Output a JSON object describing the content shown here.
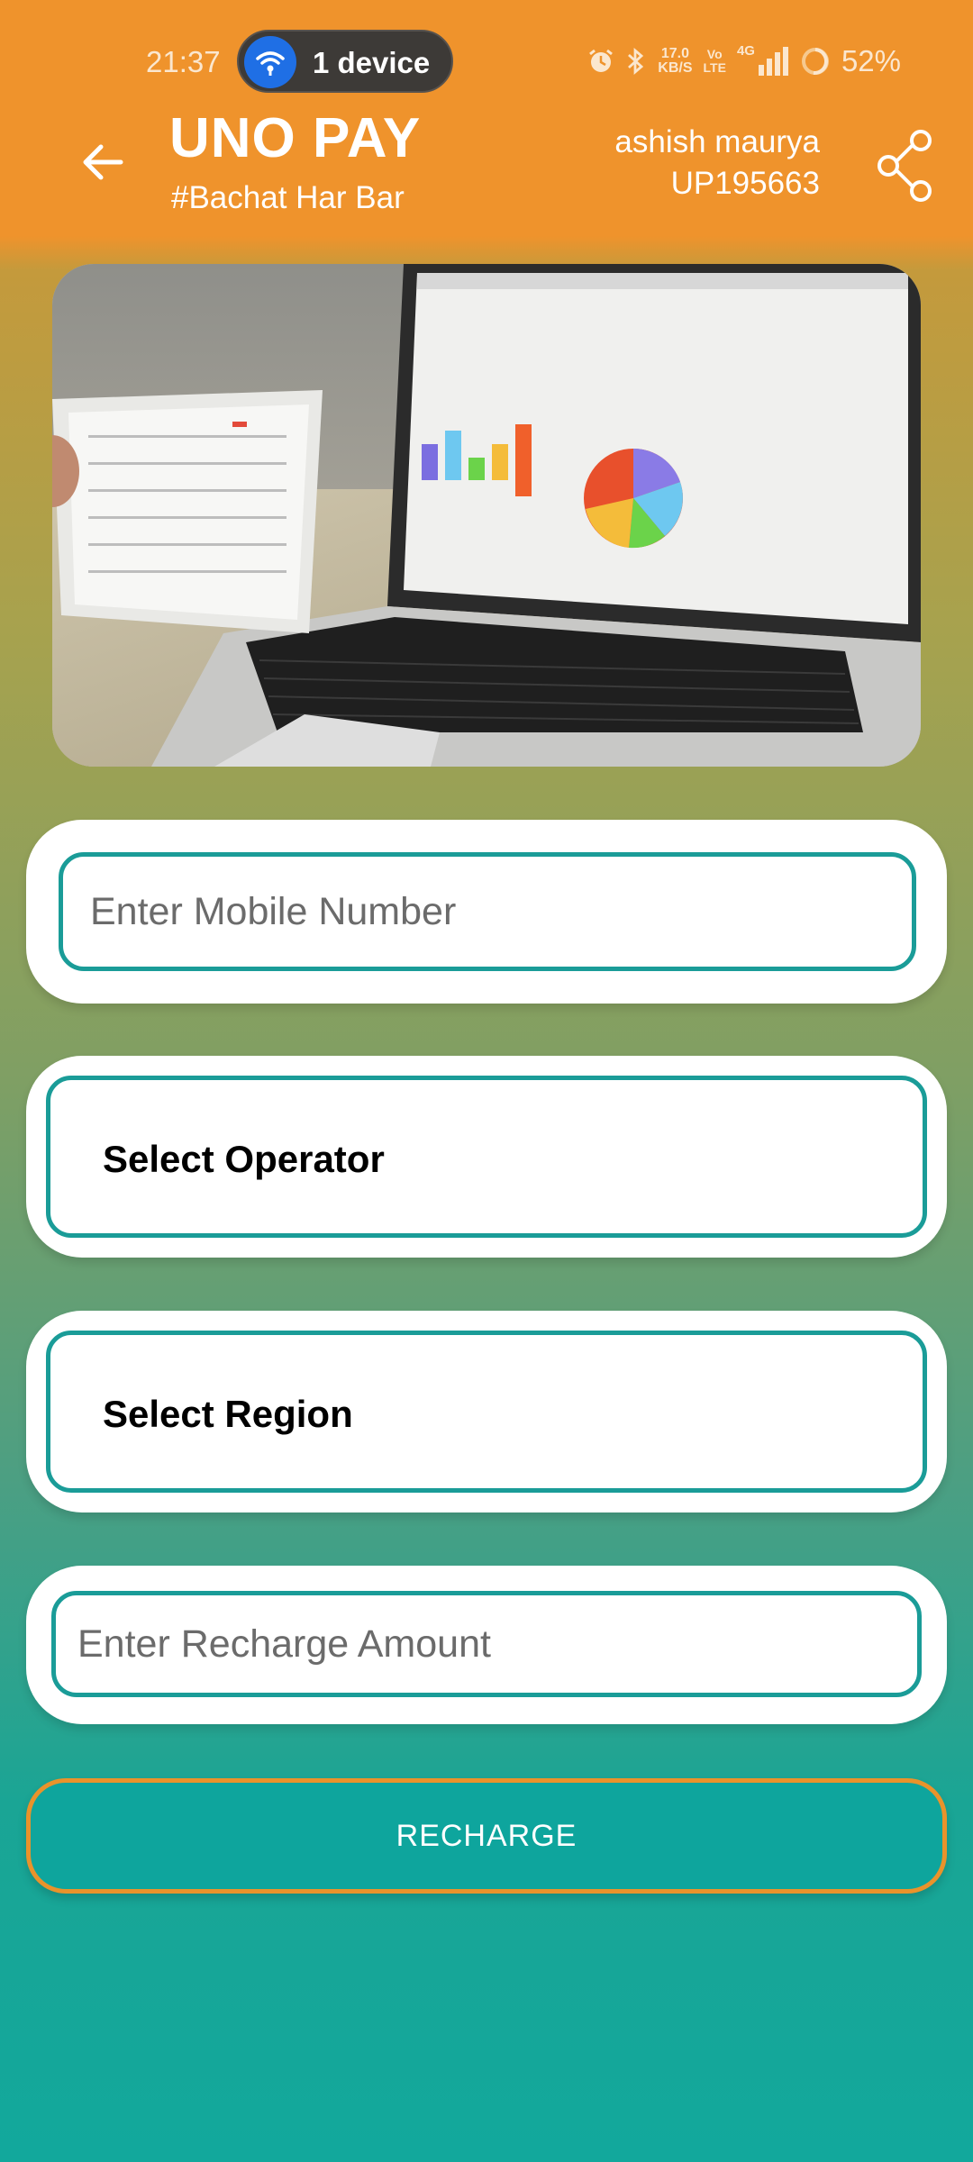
{
  "status_bar": {
    "time": "21:37",
    "hotspot_label": "1 device",
    "speed_value": "17.0",
    "speed_unit": "KB/S",
    "volte_top": "Vo",
    "volte_bottom": "LTE",
    "network": "4G",
    "battery": "52%"
  },
  "header": {
    "title": "UNO PAY",
    "tagline": "#Bachat Har Bar",
    "user_name": "ashish maurya",
    "user_id": "UP195663"
  },
  "hero": {
    "icon": "laptop-tablet-photo"
  },
  "form": {
    "mobile_placeholder": "Enter Mobile Number",
    "operator_label": "Select Operator",
    "region_label": "Select Region",
    "amount_placeholder": "Enter Recharge Amount",
    "recharge_label": "RECHARGE"
  },
  "colors": {
    "header": "#ef932c",
    "accent_border": "#1a9c98",
    "button": "#0ea59d",
    "button_border": "#e9932b"
  }
}
